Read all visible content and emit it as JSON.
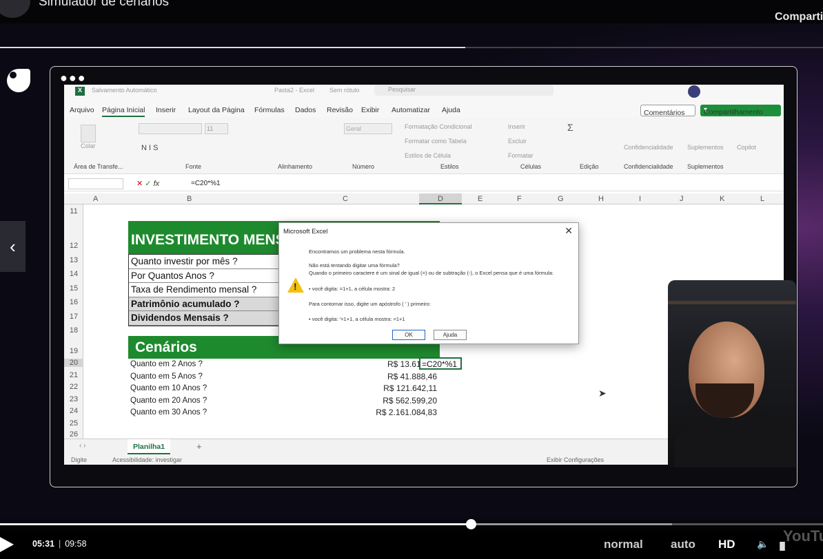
{
  "video": {
    "title": "Simulador de cenários",
    "share_label": "Comparti",
    "current_time": "05:31",
    "duration": "09:58",
    "progress_fraction": 0.572,
    "speed_label": "normal",
    "quality_auto_label": "auto",
    "hd_label": "HD",
    "yt_label": "YouTu"
  },
  "excel": {
    "titlebar": {
      "autosave": "Salvamento Automático",
      "file": "Pasta2 - Excel",
      "no_label": "Sem rótulo",
      "search_placeholder": "Pesquisar"
    },
    "menu": [
      "Arquivo",
      "Página Inicial",
      "Inserir",
      "Layout da Página",
      "Fórmulas",
      "Dados",
      "Revisão",
      "Exibir",
      "Automatizar",
      "Ajuda"
    ],
    "comments_label": "Comentários",
    "share_label": "Compartilhamento",
    "ribbon": {
      "clipboard": "Área de Transfe...",
      "paste": "Colar",
      "font": "Fonte",
      "font_size": "11",
      "font_style": "N  I  S",
      "alignment": "Alinhamento",
      "number": "Número",
      "number_format": "Geral",
      "styles": "Estilos",
      "cond_format": "Formatação Condicional",
      "format_table": "Formatar como Tabela",
      "cell_styles": "Estilos de Célula",
      "cells": "Células",
      "insert": "Inserir",
      "delete": "Excluir",
      "format": "Formatar",
      "editing": "Edição",
      "confidentiality": "Confidencialidade",
      "addins": "Suplementos",
      "copilot": "Copilot"
    },
    "formula": {
      "fx": "fx",
      "value": "=C20*%1"
    },
    "columns": [
      "A",
      "B",
      "C",
      "D",
      "E",
      "F",
      "G",
      "H",
      "I",
      "J",
      "K",
      "L"
    ],
    "rows": [
      "11",
      "12",
      "13",
      "14",
      "15",
      "16",
      "17",
      "18",
      "19",
      "20",
      "21",
      "22",
      "23",
      "24",
      "25",
      "26"
    ],
    "sheet": {
      "header1": "INVESTIMENTO MENSAL",
      "table": [
        "Quanto investir por mês ?",
        "Por Quantos Anos ?",
        "Taxa de Rendimento mensal ?",
        "Patrimônio acumulado ?",
        "Dividendos Mensais ?"
      ],
      "header2": "Cenários",
      "scenarios": [
        {
          "label": "Quanto em 2 Anos ?",
          "value": "R$ 13.613,81"
        },
        {
          "label": "Quanto em 5 Anos ?",
          "value": "R$ 41.888,46"
        },
        {
          "label": "Quanto em 10 Anos ?",
          "value": "R$ 121.642,11"
        },
        {
          "label": "Quanto em 20 Anos ?",
          "value": "R$ 562.599,20"
        },
        {
          "label": "Quanto em 30 Anos ?",
          "value": "R$ 2.161.084,83"
        }
      ],
      "editing_cell": "=C20*%1"
    },
    "sheet_tab": "Planilha1",
    "status_left": "Digite",
    "status_access": "Acessibilidade: investigar",
    "status_right": "Exibir Configurações",
    "dialog": {
      "title": "Microsoft Excel",
      "line1": "Encontramos um problema nesta fórmula.",
      "line2": "Não está tentando digitar uma fórmula?",
      "line3": "Quando o primeiro caractere é um sinal de igual (=) ou de subtração (-), o Excel pensa que é uma fórmula:",
      "line4": "• você digita:  =1+1, a célula mostra:  2",
      "line5": "Para contornar isso, digite um apóstrofo ( ' ) primeiro:",
      "line6": "• você digita:  '=1+1, a célula mostra:  =1+1",
      "ok": "OK",
      "help": "Ajuda"
    }
  }
}
